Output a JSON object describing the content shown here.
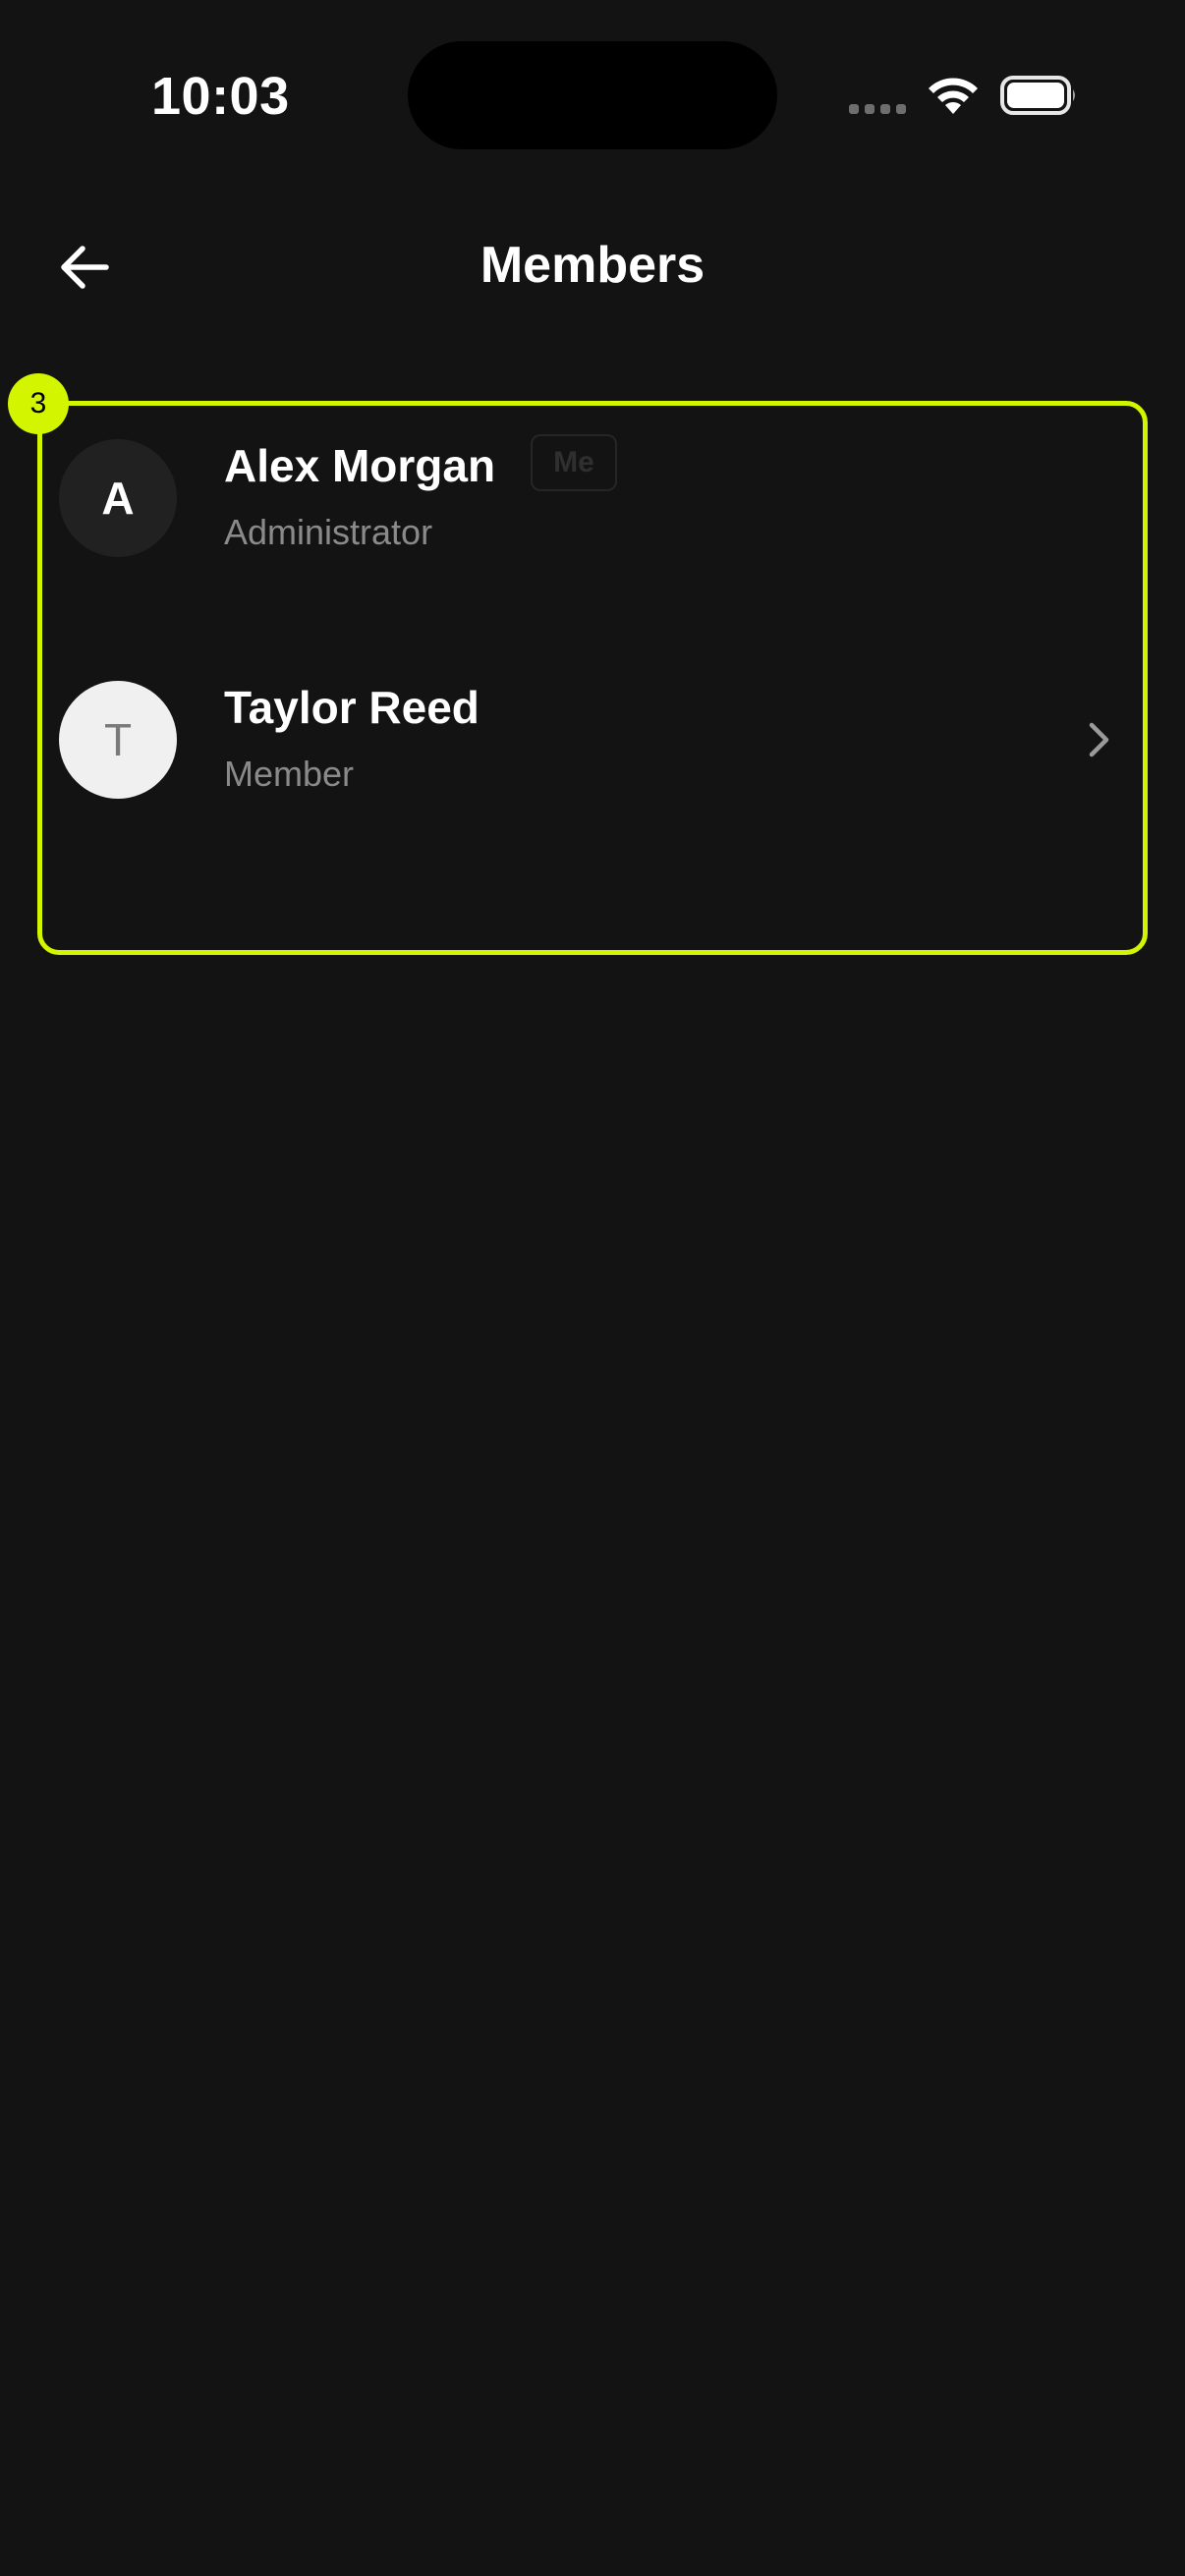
{
  "status_bar": {
    "time": "10:03",
    "icons": [
      "signal-icon",
      "wifi-icon",
      "battery-icon"
    ]
  },
  "header": {
    "title": "Members",
    "back_icon": "arrow-left-icon"
  },
  "highlight": {
    "badge_number": "3",
    "color": "#d4f500"
  },
  "members": [
    {
      "initial": "A",
      "name": "Alex Morgan",
      "role": "Administrator",
      "self_badge": "Me",
      "avatar_style": "dark"
    },
    {
      "initial": "T",
      "name": "Taylor Reed",
      "role": "Member",
      "avatar_style": "light",
      "action_icon": "chevron-right-icon"
    }
  ],
  "colors": {
    "background": "#131313",
    "text_primary": "#ffffff",
    "text_secondary": "#8a8a8a",
    "accent": "#d4f500"
  }
}
